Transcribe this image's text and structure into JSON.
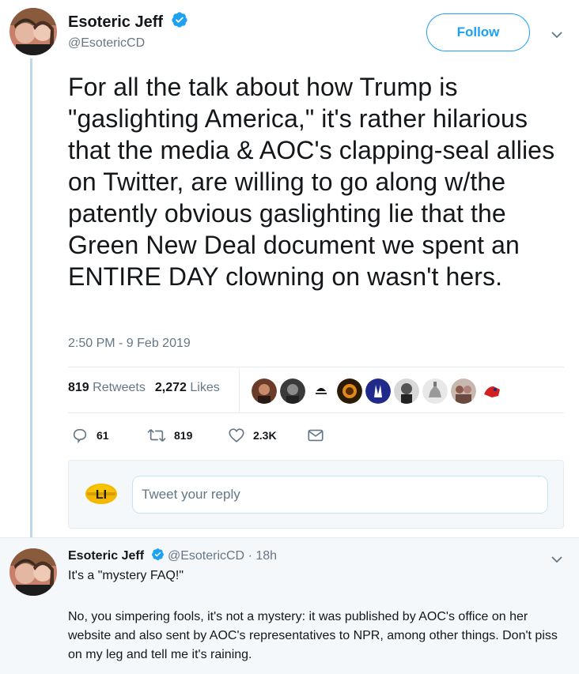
{
  "tweet": {
    "author_name": "Esoteric Jeff",
    "author_handle": "@EsotericCD",
    "follow_label": "Follow",
    "text": "For all the talk about how Trump is \"gaslighting America,\" it's rather hilarious that the media & AOC's clapping-seal allies on Twitter, are willing to go along w/the patently obvious gaslighting lie that the Green New Deal document we spent an ENTIRE DAY clowning on wasn't hers.",
    "timestamp": "2:50 PM - 9 Feb 2019",
    "retweets_count": "819",
    "retweets_label": "Retweets",
    "likes_count": "2,272",
    "likes_label": "Likes",
    "liker_avatars": [
      "liker-avatar-1",
      "liker-avatar-2",
      "liker-avatar-3",
      "liker-avatar-4",
      "liker-avatar-5",
      "liker-avatar-6",
      "liker-avatar-7",
      "liker-avatar-8",
      "liker-avatar-9"
    ],
    "actions": {
      "reply_count": "61",
      "retweet_count": "819",
      "like_count": "2.3K"
    }
  },
  "reply_box": {
    "placeholder": "Tweet your reply",
    "avatar_text": "LI"
  },
  "reply": {
    "author_name": "Esoteric Jeff",
    "author_handle": "@EsotericCD",
    "time_ago": "· 18h",
    "text_line1": "It's a \"mystery FAQ!\"",
    "text_paragraph": "No, you simpering fools, it's not a mystery: it was published by AOC's office on her website and also sent by AOC's representatives to NPR, among other things. Don't piss on my leg and tell me it's raining."
  },
  "colors": {
    "accent": "#1da1f2",
    "secondary_text": "#657786",
    "primary_text": "#14171a",
    "thread_line": "#bcd9ec",
    "reply_bg": "#f5f8fa"
  }
}
